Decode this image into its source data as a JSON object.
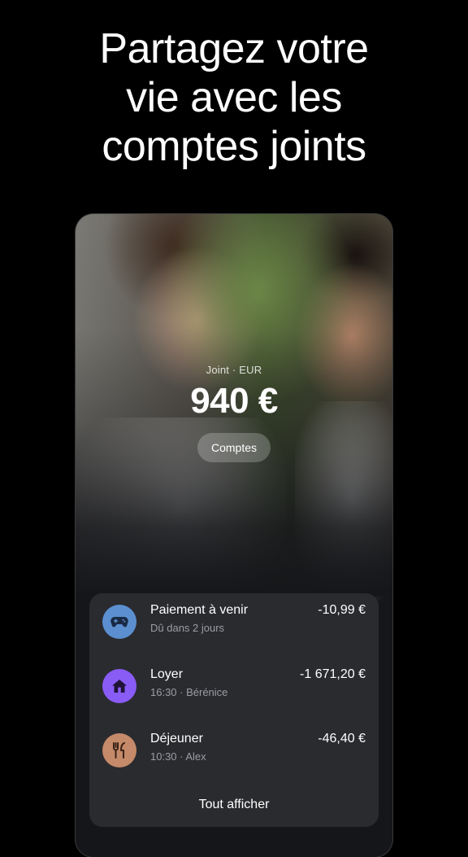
{
  "headline": {
    "line1": "Partagez votre",
    "line2": "vie avec les",
    "line3": "comptes joints"
  },
  "account": {
    "label": "Joint · EUR",
    "balance": "940 €",
    "accounts_button": "Comptes"
  },
  "transactions": [
    {
      "title": "Paiement à venir",
      "subtitle": "Dû dans 2 jours",
      "amount": "-10,99 €",
      "icon": "gamepad-icon",
      "icon_color": "#5b8fd0"
    },
    {
      "title": "Loyer",
      "subtitle": "16:30 · Bérénice",
      "amount": "-1 671,20 €",
      "icon": "house-icon",
      "icon_color": "#8a5cf6"
    },
    {
      "title": "Déjeuner",
      "subtitle": "10:30 · Alex",
      "amount": "-46,40 €",
      "icon": "cutlery-icon",
      "icon_color": "#c58a69"
    }
  ],
  "show_all": "Tout afficher"
}
